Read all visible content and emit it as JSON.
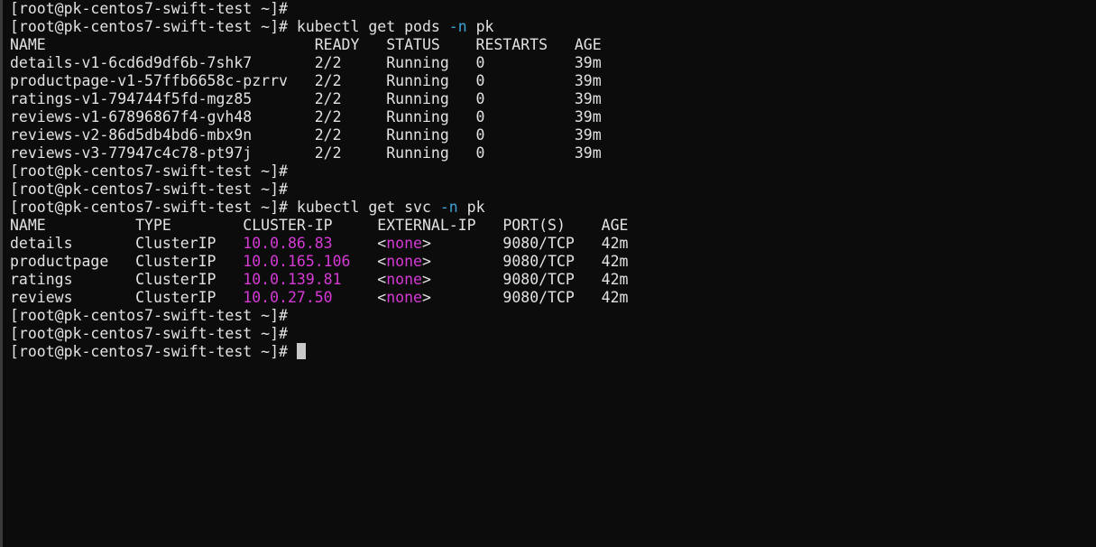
{
  "terminal": {
    "colors": {
      "background": "#0c0c0c",
      "text": "#e2e2e2",
      "flag": "#3fa3d6",
      "ip_and_none": "#d63ad6"
    },
    "lines": [
      {
        "segments": [
          {
            "text": "[root@pk-centos7-swift-test ~]#",
            "style": "plain"
          }
        ]
      },
      {
        "segments": [
          {
            "text": "[root@pk-centos7-swift-test ~]# kubectl get pods ",
            "style": "plain"
          },
          {
            "text": "-n",
            "style": "flag"
          },
          {
            "text": " pk",
            "style": "plain"
          }
        ]
      },
      {
        "segments": [
          {
            "text": "NAME                              READY   STATUS    RESTARTS   AGE",
            "style": "plain"
          }
        ]
      },
      {
        "segments": [
          {
            "text": "details-v1-6cd6d9df6b-7shk7       2/2     Running   0          39m",
            "style": "plain"
          }
        ]
      },
      {
        "segments": [
          {
            "text": "productpage-v1-57ffb6658c-pzrrv   2/2     Running   0          39m",
            "style": "plain"
          }
        ]
      },
      {
        "segments": [
          {
            "text": "ratings-v1-794744f5fd-mgz85       2/2     Running   0          39m",
            "style": "plain"
          }
        ]
      },
      {
        "segments": [
          {
            "text": "reviews-v1-67896867f4-gvh48       2/2     Running   0          39m",
            "style": "plain"
          }
        ]
      },
      {
        "segments": [
          {
            "text": "reviews-v2-86d5db4bd6-mbx9n       2/2     Running   0          39m",
            "style": "plain"
          }
        ]
      },
      {
        "segments": [
          {
            "text": "reviews-v3-77947c4c78-pt97j       2/2     Running   0          39m",
            "style": "plain"
          }
        ]
      },
      {
        "segments": [
          {
            "text": "[root@pk-centos7-swift-test ~]#",
            "style": "plain"
          }
        ]
      },
      {
        "segments": [
          {
            "text": "[root@pk-centos7-swift-test ~]#",
            "style": "plain"
          }
        ]
      },
      {
        "segments": [
          {
            "text": "[root@pk-centos7-swift-test ~]# kubectl get svc ",
            "style": "plain"
          },
          {
            "text": "-n",
            "style": "flag"
          },
          {
            "text": " pk",
            "style": "plain"
          }
        ]
      },
      {
        "segments": [
          {
            "text": "NAME          TYPE        CLUSTER-IP     EXTERNAL-IP   PORT(S)    AGE",
            "style": "plain"
          }
        ]
      },
      {
        "segments": [
          {
            "text": "details       ClusterIP   ",
            "style": "plain"
          },
          {
            "text": "10.0.86.83",
            "style": "ip"
          },
          {
            "text": "     <",
            "style": "plain"
          },
          {
            "text": "none",
            "style": "none"
          },
          {
            "text": ">        9080/TCP   42m",
            "style": "plain"
          }
        ]
      },
      {
        "segments": [
          {
            "text": "productpage   ClusterIP   ",
            "style": "plain"
          },
          {
            "text": "10.0.165.106",
            "style": "ip"
          },
          {
            "text": "   <",
            "style": "plain"
          },
          {
            "text": "none",
            "style": "none"
          },
          {
            "text": ">        9080/TCP   42m",
            "style": "plain"
          }
        ]
      },
      {
        "segments": [
          {
            "text": "ratings       ClusterIP   ",
            "style": "plain"
          },
          {
            "text": "10.0.139.81",
            "style": "ip"
          },
          {
            "text": "    <",
            "style": "plain"
          },
          {
            "text": "none",
            "style": "none"
          },
          {
            "text": ">        9080/TCP   42m",
            "style": "plain"
          }
        ]
      },
      {
        "segments": [
          {
            "text": "reviews       ClusterIP   ",
            "style": "plain"
          },
          {
            "text": "10.0.27.50",
            "style": "ip"
          },
          {
            "text": "     <",
            "style": "plain"
          },
          {
            "text": "none",
            "style": "none"
          },
          {
            "text": ">        9080/TCP   42m",
            "style": "plain"
          }
        ]
      },
      {
        "segments": [
          {
            "text": "[root@pk-centos7-swift-test ~]#",
            "style": "plain"
          }
        ]
      },
      {
        "segments": [
          {
            "text": "[root@pk-centos7-swift-test ~]#",
            "style": "plain"
          }
        ]
      },
      {
        "segments": [
          {
            "text": "[root@pk-centos7-swift-test ~]# ",
            "style": "plain"
          }
        ],
        "cursor": true
      }
    ]
  }
}
